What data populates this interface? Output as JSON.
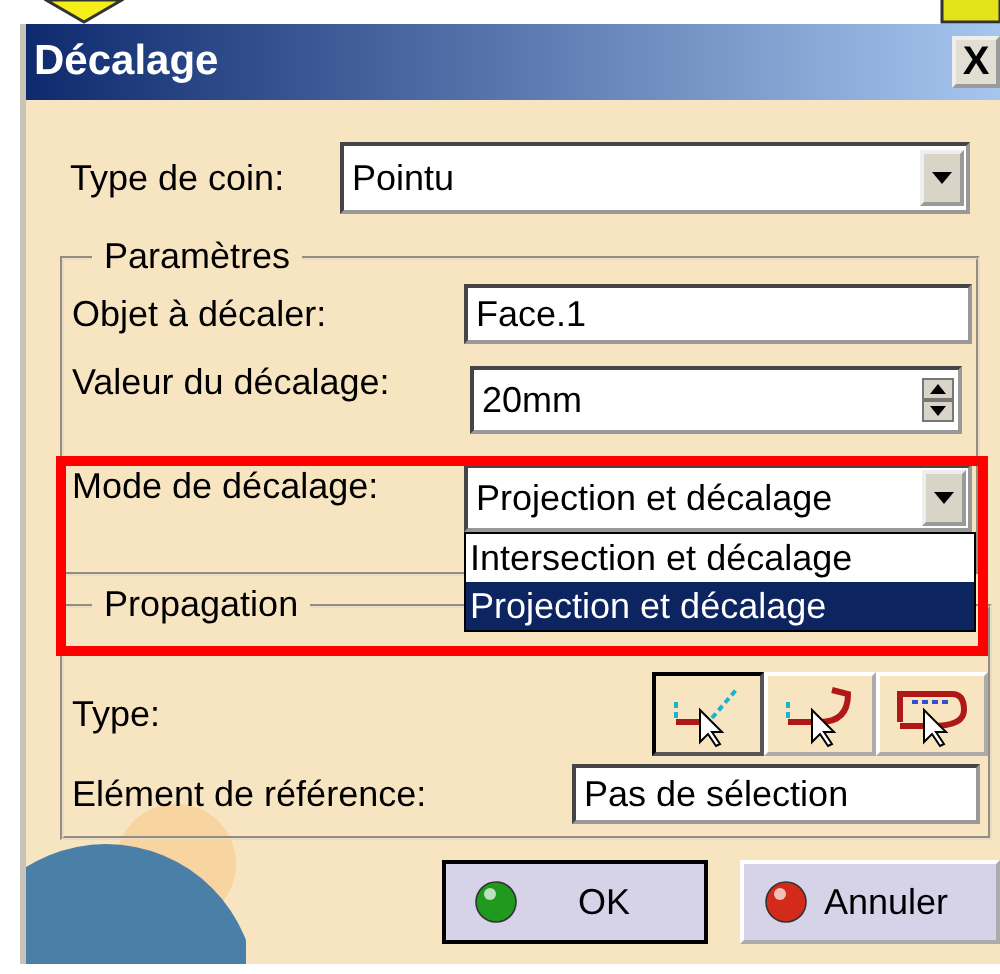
{
  "window": {
    "title": "Décalage",
    "close": "X"
  },
  "corner_type": {
    "label": "Type de coin:",
    "value": "Pointu"
  },
  "parameters": {
    "title": "Paramètres",
    "object": {
      "label": "Objet à décaler:",
      "value": "Face.1"
    },
    "offset": {
      "label": "Valeur du décalage:",
      "value": "20mm"
    },
    "mode": {
      "label": "Mode de décalage:",
      "value": "Projection et décalage",
      "expanded": true,
      "options": [
        {
          "label": "Intersection et décalage",
          "selected": false
        },
        {
          "label": "Projection et décalage",
          "selected": true
        }
      ]
    }
  },
  "propagation": {
    "title": "Propagation",
    "type_label": "Type:",
    "reference": {
      "label": "Elément de référence:",
      "value": "Pas de sélection"
    }
  },
  "buttons": [
    {
      "label": "OK",
      "kind": "ok"
    },
    {
      "label": "Annuler",
      "kind": "cancel"
    }
  ]
}
